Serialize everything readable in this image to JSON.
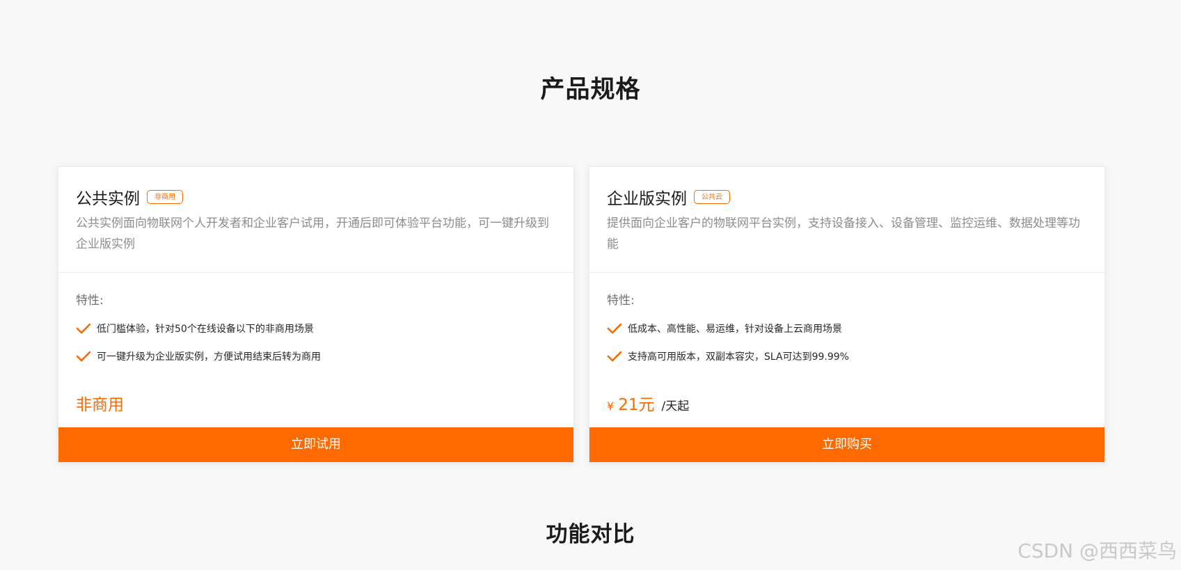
{
  "headings": {
    "specs": "产品规格",
    "compare": "功能对比"
  },
  "cards": [
    {
      "title": "公共实例",
      "tag": "非商用",
      "description": "公共实例面向物联网个人开发者和企业客户试用，开通后即可体验平台功能，可一键升级到企业版实例",
      "features_label": "特性:",
      "features": [
        "低门槛体验，针对50个在线设备以下的非商用场景",
        "可一键升级为企业版实例，方便试用结束后转为商用"
      ],
      "price_text": "非商用",
      "button_label": "立即试用"
    },
    {
      "title": "企业版实例",
      "tag": "公共云",
      "description": "提供面向企业客户的物联网平台实例，支持设备接入、设备管理、监控运维、数据处理等功能",
      "features_label": "特性:",
      "features": [
        "低成本、高性能、易运维，针对设备上云商用场景",
        "支持高可用版本，双副本容灾，SLA可达到99.99%"
      ],
      "price_currency": "¥",
      "price_amount": "21元",
      "price_unit": "/天起",
      "button_label": "立即购买"
    }
  ],
  "watermark": "CSDN @西西菜鸟",
  "colors": {
    "accent": "#ff6a00",
    "background": "#f8f8f8",
    "card": "#ffffff"
  },
  "icons": {
    "feature_bullet": "check-icon"
  }
}
